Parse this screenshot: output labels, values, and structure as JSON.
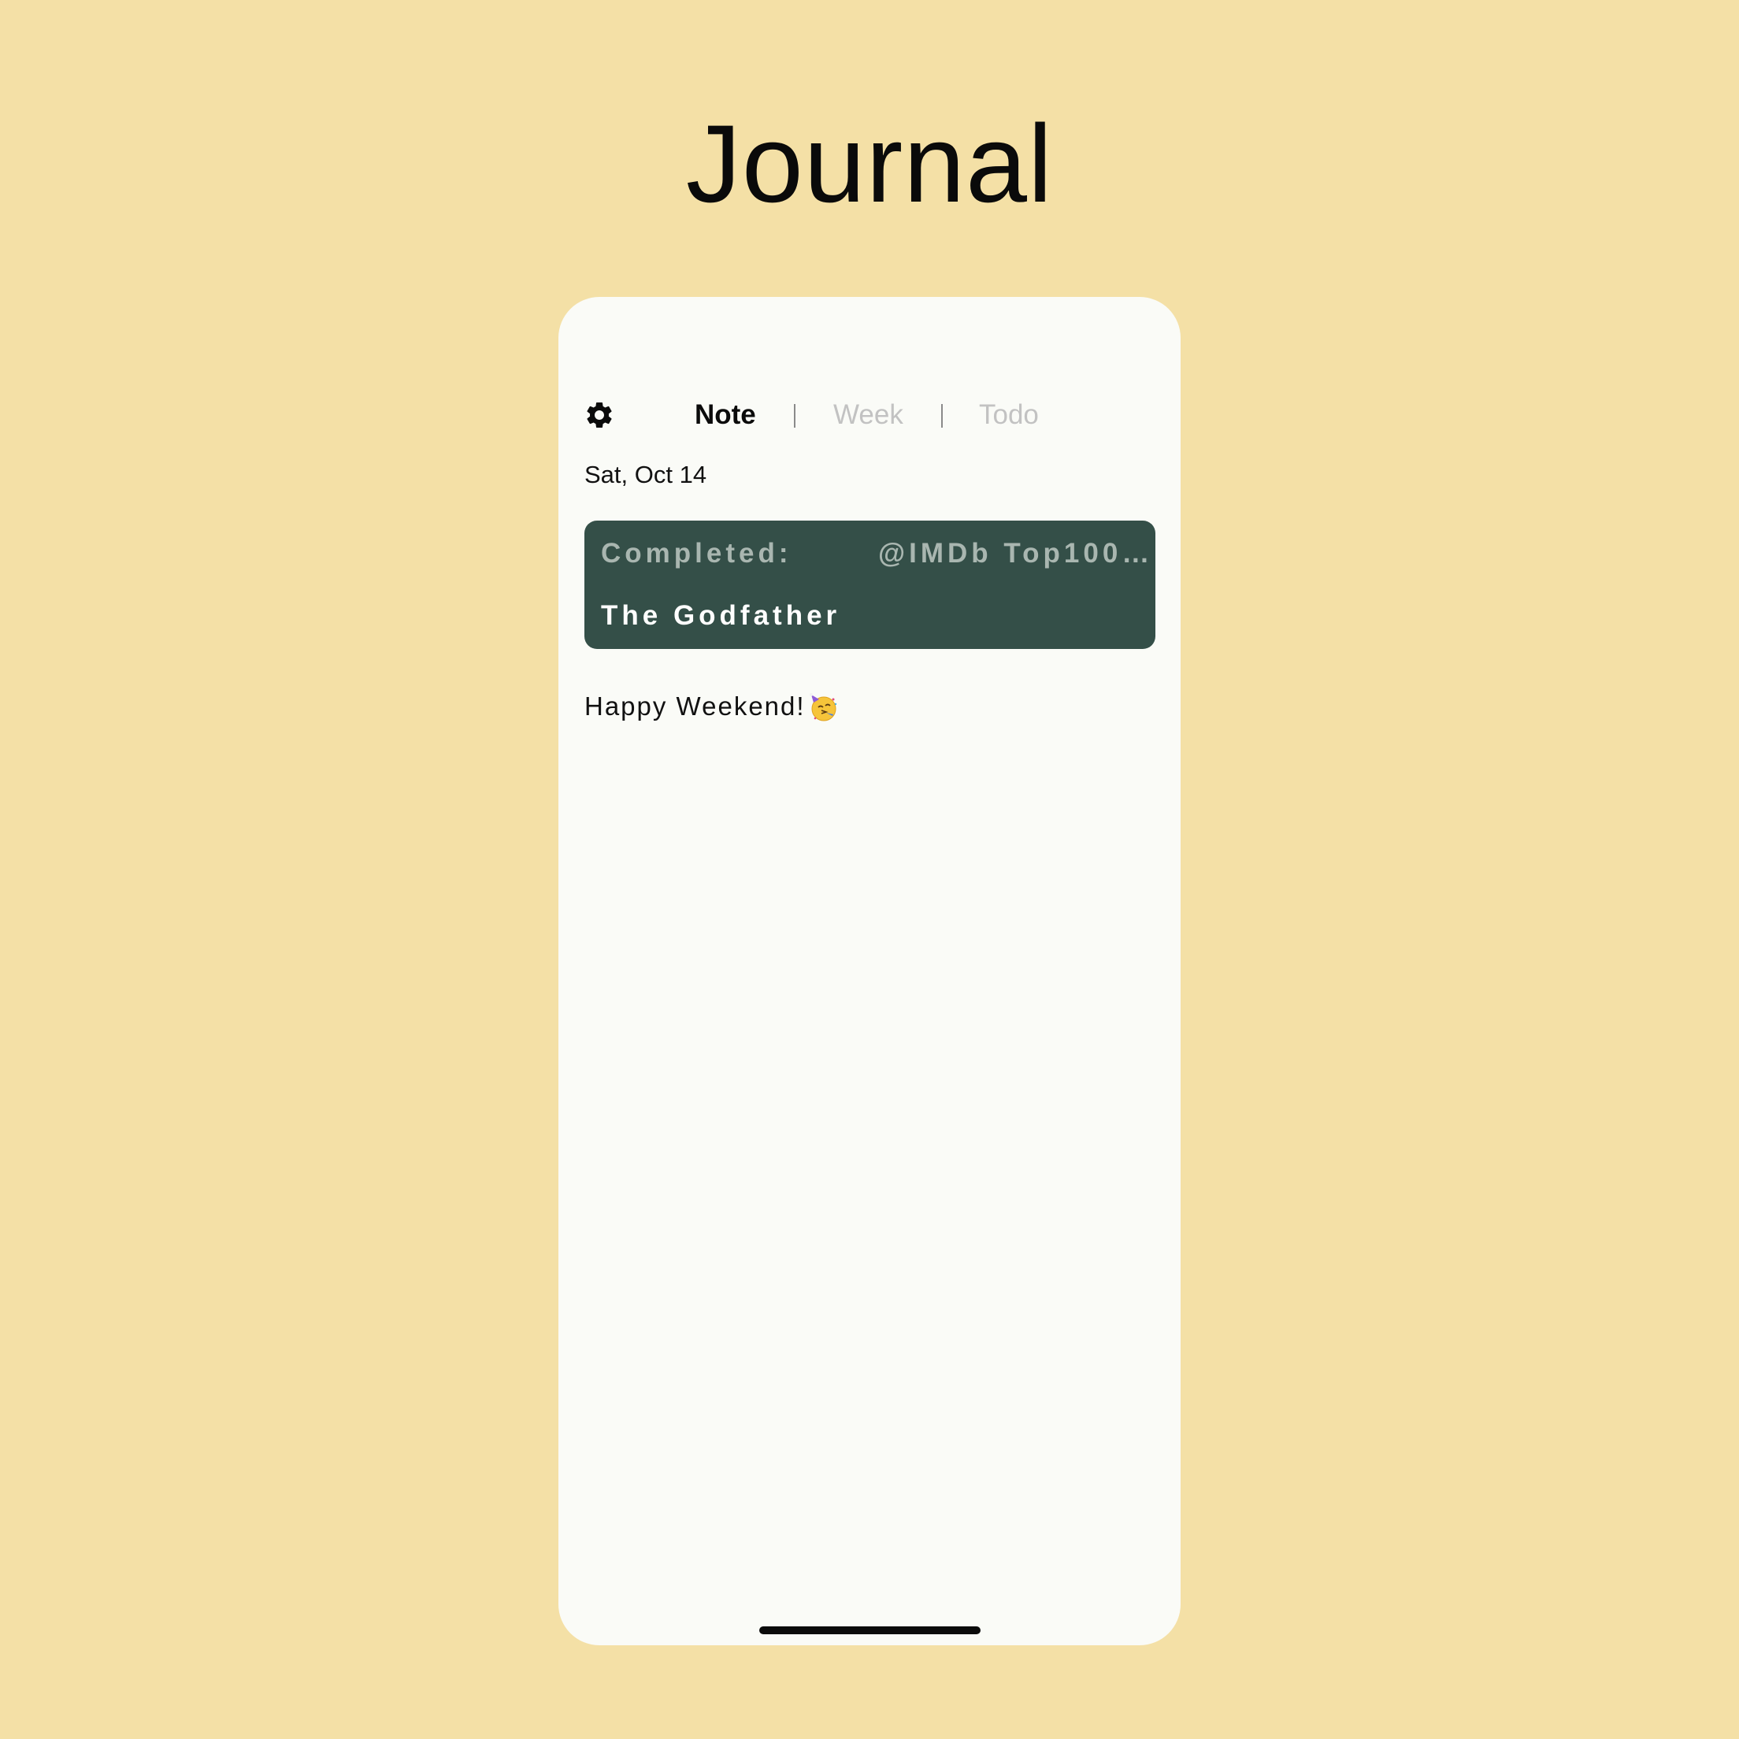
{
  "page": {
    "title": "Journal"
  },
  "tabs": [
    {
      "label": "Note",
      "active": true
    },
    {
      "label": "Week",
      "active": false
    },
    {
      "label": "Todo",
      "active": false
    }
  ],
  "note": {
    "date": "Sat, Oct 14",
    "card": {
      "label": "Completed:",
      "list": "@IMDb Top100…",
      "title": "The Godfather"
    },
    "text": "Happy Weekend!"
  },
  "icons": {
    "settings": "gear-icon",
    "emoji": "partying-face-emoji"
  },
  "colors": {
    "background": "#f4e0a6",
    "screen": "#fafbf7",
    "card": "#344f48",
    "tab_inactive": "#c2c2c2"
  }
}
